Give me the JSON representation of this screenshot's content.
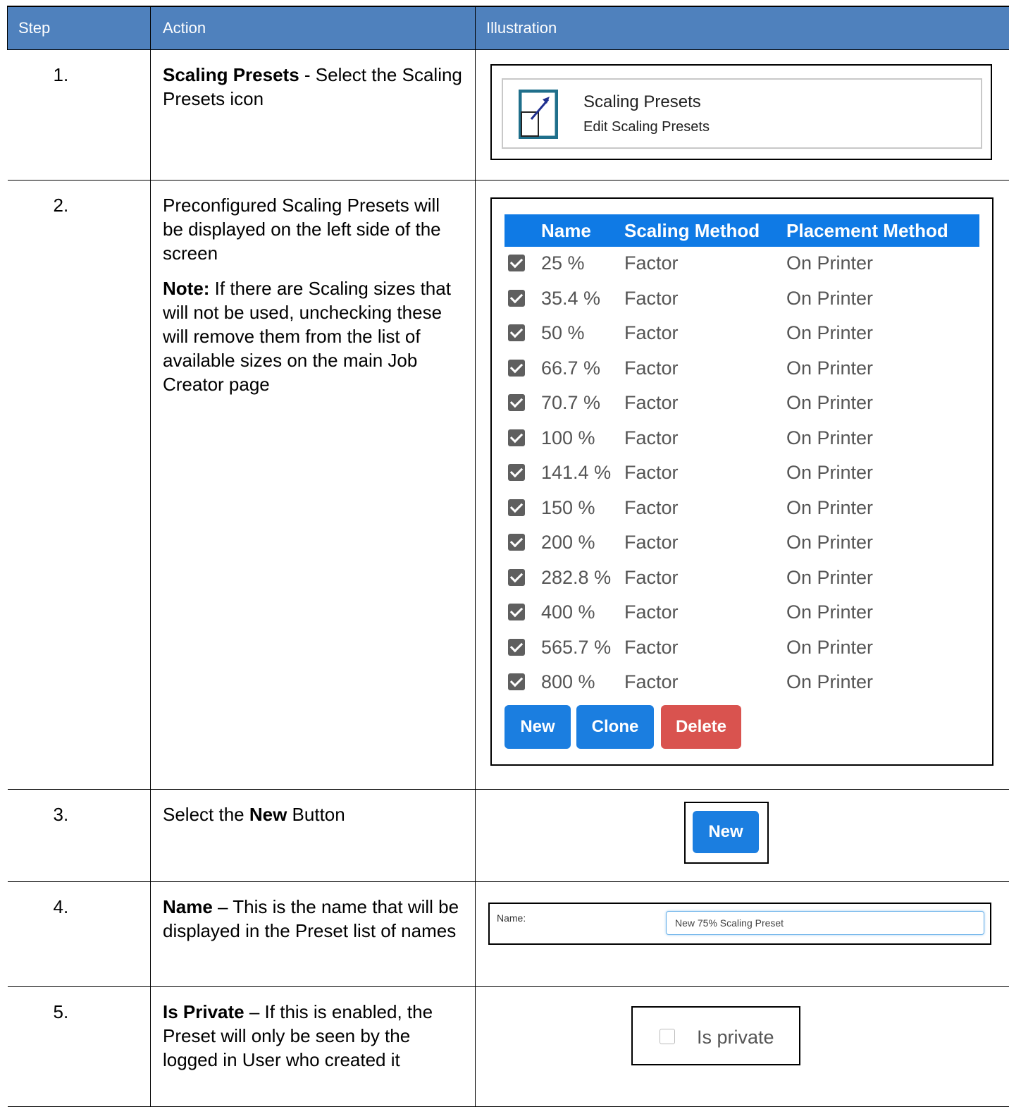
{
  "header": {
    "step": "Step",
    "action": "Action",
    "illustration": "Illustration"
  },
  "rows": [
    {
      "num": "1.",
      "action_bold": "Scaling Presets",
      "action_rest": " - Select the Scaling Presets icon"
    },
    {
      "num": "2.",
      "action_p1": "Preconfigured Scaling Presets will be displayed on the left side of the screen",
      "note_bold": "Note:",
      "note_rest": " If there are Scaling sizes that will not be used, unchecking these will remove them from the list of available sizes on the main Job Creator page"
    },
    {
      "num": "3.",
      "pre": "Select the ",
      "bold": "New",
      "post": " Button"
    },
    {
      "num": "4.",
      "action_bold": "Name",
      "action_rest": " – This is the name that will be displayed in the Preset list of names"
    },
    {
      "num": "5.",
      "action_bold": "Is Private",
      "action_rest": " – If this is enabled, the Preset will only be seen by the logged in User who created it"
    }
  ],
  "illus1": {
    "title": "Scaling Presets",
    "subtitle": "Edit Scaling Presets",
    "icon": "scaling-presets-icon"
  },
  "illus2": {
    "columns": [
      "Name",
      "Scaling Method",
      "Placement Method"
    ],
    "presets": [
      {
        "name": "25 %",
        "scaling": "Factor",
        "placement": "On Printer",
        "checked": true
      },
      {
        "name": "35.4 %",
        "scaling": "Factor",
        "placement": "On Printer",
        "checked": true
      },
      {
        "name": "50 %",
        "scaling": "Factor",
        "placement": "On Printer",
        "checked": true
      },
      {
        "name": "66.7 %",
        "scaling": "Factor",
        "placement": "On Printer",
        "checked": true
      },
      {
        "name": "70.7 %",
        "scaling": "Factor",
        "placement": "On Printer",
        "checked": true
      },
      {
        "name": "100 %",
        "scaling": "Factor",
        "placement": "On Printer",
        "checked": true
      },
      {
        "name": "141.4 %",
        "scaling": "Factor",
        "placement": "On Printer",
        "checked": true
      },
      {
        "name": "150 %",
        "scaling": "Factor",
        "placement": "On Printer",
        "checked": true
      },
      {
        "name": "200 %",
        "scaling": "Factor",
        "placement": "On Printer",
        "checked": true
      },
      {
        "name": "282.8 %",
        "scaling": "Factor",
        "placement": "On Printer",
        "checked": true
      },
      {
        "name": "400 %",
        "scaling": "Factor",
        "placement": "On Printer",
        "checked": true
      },
      {
        "name": "565.7 %",
        "scaling": "Factor",
        "placement": "On Printer",
        "checked": true
      },
      {
        "name": "800 %",
        "scaling": "Factor",
        "placement": "On Printer",
        "checked": true
      }
    ],
    "buttons": {
      "new": "New",
      "clone": "Clone",
      "delete": "Delete"
    }
  },
  "illus3": {
    "button": "New"
  },
  "illus4": {
    "label": "Name:",
    "value": "New 75% Scaling Preset"
  },
  "illus5": {
    "label": "Is private",
    "checked": false
  },
  "colors": {
    "header_bg": "#4f81bd",
    "table_header_bg": "#0f7ae5",
    "button_blue": "#1b7ee0",
    "button_red": "#d9534f"
  }
}
